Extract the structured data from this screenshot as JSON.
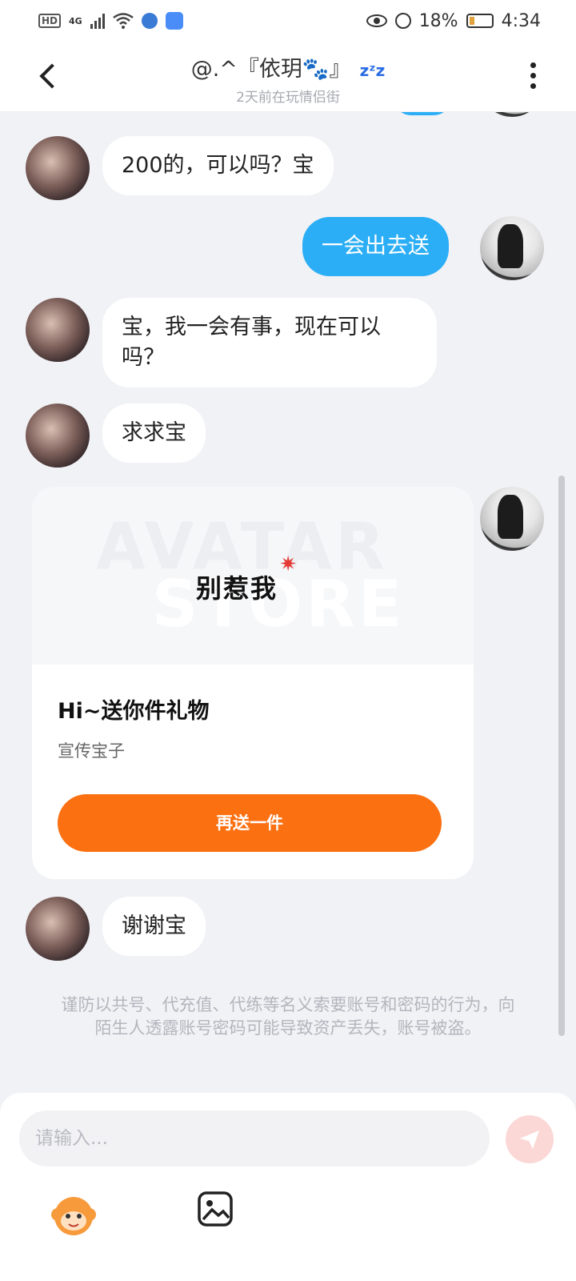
{
  "status_bar": {
    "network": "4G",
    "battery": "18%",
    "time": "4:34"
  },
  "header": {
    "title": "@.^『依玥🐾』",
    "status_icon_text": "zᶻz",
    "subtitle": "2天前在玩情侣街"
  },
  "messages": [
    {
      "from": "other",
      "text": "200的，可以吗？宝"
    },
    {
      "from": "me",
      "text": "一会出去送"
    },
    {
      "from": "other",
      "text": "宝，我一会有事，现在可以吗？"
    },
    {
      "from": "other",
      "text": "求求宝"
    },
    {
      "from": "other",
      "text": "谢谢宝"
    }
  ],
  "gift": {
    "sticker_text": "别惹我",
    "watermark_1": "AVATAR",
    "watermark_2": "STORE",
    "title": "Hi~送你件礼物",
    "description": "宣传宝子",
    "button_label": "再送一件"
  },
  "warning": "谨防以共号、代充值、代练等名义索要账号和密码的行为，向陌生人透露账号密码可能导致资产丢失，账号被盗。",
  "input": {
    "placeholder": "请输入..."
  },
  "colors": {
    "my_bubble": "#2baef5",
    "gift_button": "#fb7011",
    "send_button": "#fbd8d6"
  }
}
